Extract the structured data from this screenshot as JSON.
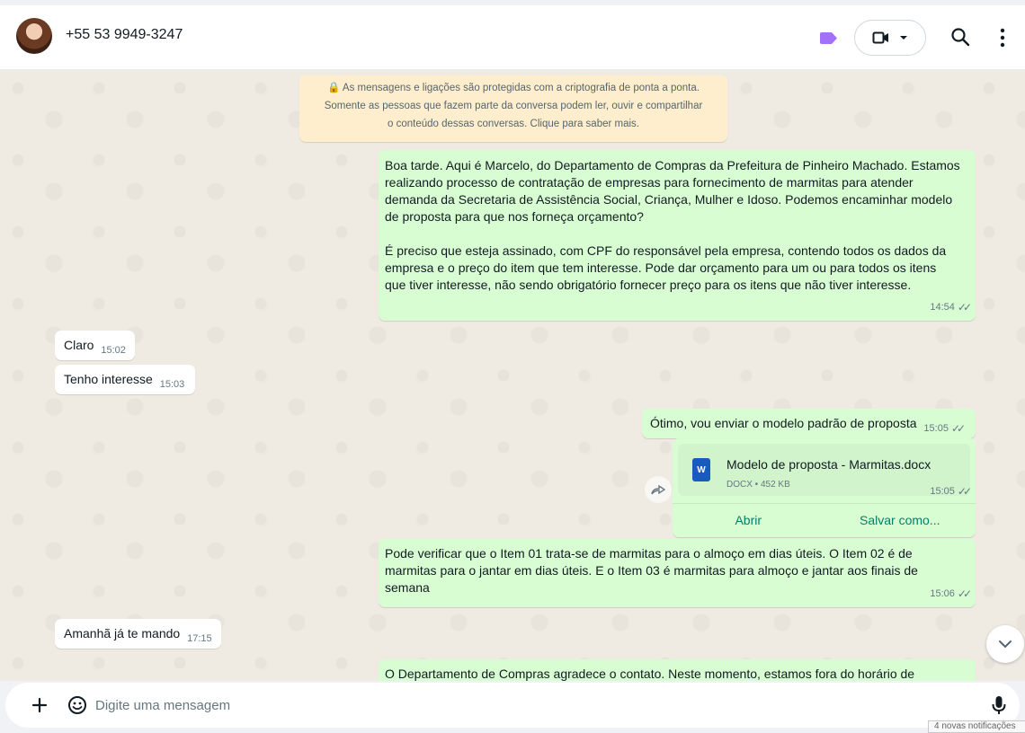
{
  "header": {
    "contact_name": "+55 53 9949-3247",
    "label_color": "#a371f7",
    "icons": [
      "label-icon",
      "video-call-icon",
      "chevron-down-icon",
      "search-icon",
      "menu-dots-icon"
    ]
  },
  "encryption_notice": {
    "line1": "🔒 As mensagens e ligações são protegidas com a criptografia de ponta a ponta.",
    "line2": "Somente as pessoas que fazem parte da conversa podem ler, ouvir e compartilhar",
    "line3": "o conteúdo dessas conversas. Clique para saber mais."
  },
  "messages": [
    {
      "direction": "out",
      "text": "Boa tarde. Aqui é Marcelo, do Departamento de Compras da Prefeitura de Pinheiro Machado. Estamos\nrealizando processo de contratação de empresas para fornecimento de marmitas para atender\ndemanda da Secretaria de Assistência Social, Criança, Mulher e Idoso. Podemos encaminhar modelo\nde proposta para que nos forneça orçamento?\n\nÉ preciso que esteja assinado, com CPF do responsável pela empresa, contendo todos os dados da\nempresa e o preço do item que tem interesse. Pode dar orçamento para um ou para todos os itens\nque tiver interesse, não sendo obrigatório fornecer preço para os itens que não tiver interesse.",
      "time": "14:54"
    },
    {
      "direction": "in",
      "text": "Claro",
      "time": "15:02"
    },
    {
      "direction": "in",
      "text": "Tenho interesse",
      "time": "15:03"
    },
    {
      "direction": "out",
      "text": "Ótimo, vou enviar o modelo padrão de proposta",
      "time": "15:05"
    },
    {
      "direction": "out",
      "document": {
        "name": "Modelo de proposta - Marmitas.docx",
        "meta": "DOCX • 452 KB",
        "icon_letter": "W",
        "open_label": "Abrir",
        "save_label": "Salvar como..."
      },
      "time": "15:05"
    },
    {
      "direction": "out",
      "text": "Pode verificar que o Item 01 trata-se de marmitas para o almoço em dias úteis. O Item 02 é de\nmarmitas para o jantar em dias úteis. E o Item 03 é marmitas para almoço e jantar aos finais de\nsemana",
      "time": "15:06"
    },
    {
      "direction": "in",
      "text": "Amanhã já te mando",
      "time": "17:15"
    },
    {
      "direction": "out",
      "text": "O Departamento de Compras agradece o contato. Neste momento, estamos fora do horário de"
    }
  ],
  "composer": {
    "placeholder": "Digite uma mensagem"
  },
  "notification_badge": "4 novas notificações",
  "colors": {
    "outgoing_bubble": "#d9fdd3",
    "incoming_bubble": "#ffffff",
    "chat_background": "#efeae2",
    "accent": "#008069"
  }
}
